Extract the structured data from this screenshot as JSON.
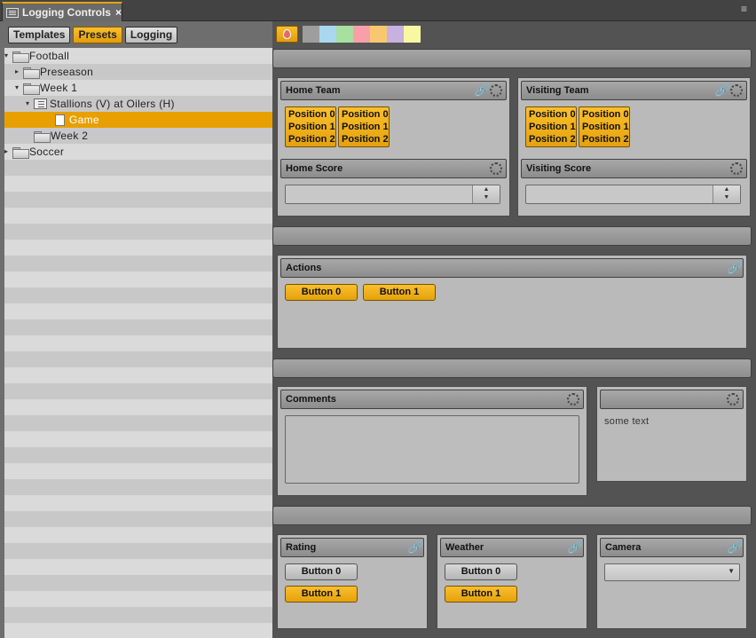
{
  "window": {
    "tab_title": "Logging Controls",
    "close_glyph": "×",
    "menu_glyph": "≡"
  },
  "modes": {
    "templates": "Templates",
    "presets": "Presets",
    "logging": "Logging",
    "active": "Presets"
  },
  "tree": {
    "items": [
      {
        "label": "Football",
        "expander": "▾",
        "icon": "folder-icon"
      },
      {
        "label": "Preseason",
        "expander": "▸",
        "icon": "folder-icon"
      },
      {
        "label": "Week 1",
        "expander": "▾",
        "icon": "folder-icon"
      },
      {
        "label": "Stallions (V) at Oilers (H)",
        "expander": "▾",
        "icon": "sequence-icon"
      },
      {
        "label": "Game",
        "expander": "",
        "icon": "document-icon",
        "selected": true
      },
      {
        "label": "Week 2",
        "expander": "",
        "icon": "folder-icon"
      },
      {
        "label": "Soccer",
        "expander": "▸",
        "icon": "folder-icon"
      }
    ]
  },
  "colors": {
    "accent": "#e8a000",
    "swatches": [
      "#9e9e9e",
      "#a8d8f0",
      "#a8e0a0",
      "#f8a0a8",
      "#f8c870",
      "#c8b0e0",
      "#f8f8a0"
    ]
  },
  "home_team": {
    "title": "Home Team",
    "positions": [
      "Position 0",
      "Position 1",
      "Position 2"
    ]
  },
  "visiting_team": {
    "title": "Visiting Team",
    "positions": [
      "Position 0",
      "Position 1",
      "Position 2"
    ]
  },
  "home_score": {
    "title": "Home Score",
    "value": ""
  },
  "visiting_score": {
    "title": "Visiting Score",
    "value": ""
  },
  "actions": {
    "title": "Actions",
    "button0": "Button 0",
    "button1": "Button 1"
  },
  "comments": {
    "title": "Comments",
    "value": ""
  },
  "untitled_panel": {
    "title": "",
    "text": "some text"
  },
  "rating": {
    "title": "Rating",
    "button0": "Button 0",
    "button1": "Button 1"
  },
  "weather": {
    "title": "Weather",
    "button0": "Button 0",
    "button1": "Button 1"
  },
  "camera": {
    "title": "Camera",
    "value": ""
  }
}
